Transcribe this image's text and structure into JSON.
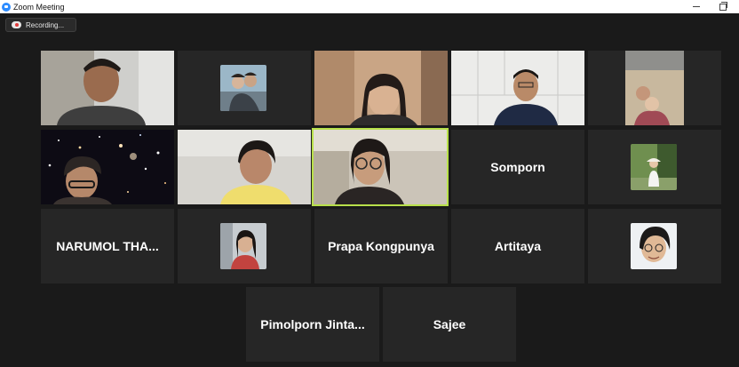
{
  "window": {
    "title": "Zoom Meeting"
  },
  "recording": {
    "label": "Recording..."
  },
  "participants": [
    {
      "name": "",
      "kind": "video"
    },
    {
      "name": "",
      "kind": "photo"
    },
    {
      "name": "",
      "kind": "video"
    },
    {
      "name": "",
      "kind": "video"
    },
    {
      "name": "",
      "kind": "video"
    },
    {
      "name": "",
      "kind": "video"
    },
    {
      "name": "",
      "kind": "video"
    },
    {
      "name": "",
      "kind": "video",
      "active_speaker": true
    },
    {
      "name": "Somporn",
      "kind": "name"
    },
    {
      "name": "",
      "kind": "photo"
    },
    {
      "name": "NARUMOL THA...",
      "kind": "name"
    },
    {
      "name": "",
      "kind": "photo"
    },
    {
      "name": "Prapa Kongpunya",
      "kind": "name"
    },
    {
      "name": "Artitaya",
      "kind": "name"
    },
    {
      "name": "",
      "kind": "photo"
    },
    {
      "name": "Pimolporn Jinta...",
      "kind": "name"
    },
    {
      "name": "Sajee",
      "kind": "name"
    }
  ],
  "colors": {
    "background": "#1a1a1a",
    "tile": "#262626",
    "active_border": "#b8e04a"
  }
}
